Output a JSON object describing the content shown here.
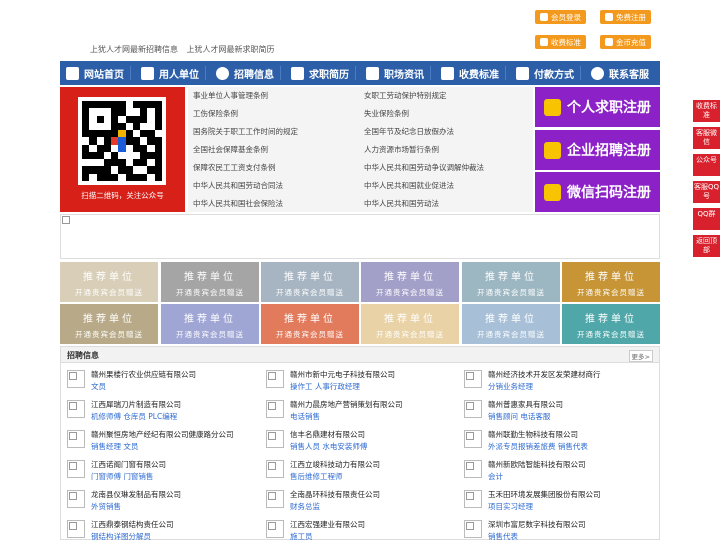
{
  "top": {
    "member_login": "会员登录",
    "free_register": "免费注册",
    "fee_standard": "收费标准",
    "gold_recharge": "金币充值",
    "newest_jobs": "上犹人才网最新招聘信息",
    "newest_resumes": "上犹人才网最新求职简历"
  },
  "nav": [
    "网站首页",
    "用人单位",
    "招聘信息",
    "求职简历",
    "职场资讯",
    "收费标准",
    "付款方式",
    "联系客服"
  ],
  "qr_caption": "扫描二维码，关注公众号",
  "laws": [
    "事业单位人事管理条例",
    "女职工劳动保护特别规定",
    "工伤保险条例",
    "失业保险条例",
    "国务院关于职工工作时间的规定",
    "全国年节及纪念日放假办法",
    "全国社会保障基金条例",
    "人力资源市场暂行条例",
    "保障农民工工资支付条例",
    "中华人民共和国劳动争议调解仲裁法",
    "中华人民共和国劳动合同法",
    "中华人民共和国就业促进法",
    "中华人民共和国社会保险法",
    "中华人民共和国劳动法"
  ],
  "register": {
    "personal": "个人求职注册",
    "company": "企业招聘注册",
    "wechat": "微信扫码注册"
  },
  "tiles": {
    "title": "推荐单位",
    "subtitle": "开通贵宾会员赠送",
    "colors": [
      "#d9cfb8",
      "#a5a5a5",
      "#a7b4c2",
      "#a29fc8",
      "#9db7c2",
      "#c79535",
      "#b8aa88",
      "#9fa6d4",
      "#e27a5c",
      "#e8d2a6",
      "#a7c0d8",
      "#4fa7a9"
    ]
  },
  "jobs": {
    "title": "招聘信息",
    "more": "更多>",
    "items": [
      {
        "company": "赣州果楼行农业供应链有限公司",
        "positions": "文员"
      },
      {
        "company": "赣州市新中元电子科技有限公司",
        "positions": "操作工 人事行政经理"
      },
      {
        "company": "赣州经济技术开发区发荣建材商行",
        "positions": "分销业务经理"
      },
      {
        "company": "江西犀瑞刀片制造有限公司",
        "positions": "机修师傅 仓库员 PLC编程"
      },
      {
        "company": "赣州力晨房地产营销策划有限公司",
        "positions": "电话销售"
      },
      {
        "company": "赣州普惠家具有限公司",
        "positions": "销售顾问 电话客服"
      },
      {
        "company": "赣州聚恒房地产经纪有限公司健康路分公司",
        "positions": "销售经理 文员"
      },
      {
        "company": "信丰名鼎建材有限公司",
        "positions": "销售人员 水电安装师傅"
      },
      {
        "company": "赣州联勤生物科技有限公司",
        "positions": "外派专员报销差旅费 销售代表"
      },
      {
        "company": "江西诺阁门窗有限公司",
        "positions": "门窗师傅 门窗销售"
      },
      {
        "company": "江西立竣科技动力有限公司",
        "positions": "售后维修工程师"
      },
      {
        "company": "赣州新欧陆智能科技有限公司",
        "positions": "会计"
      },
      {
        "company": "龙南县仪琳发制品有限公司",
        "positions": "外贸销售"
      },
      {
        "company": "全南晶环科技有限责任公司",
        "positions": "财务总监"
      },
      {
        "company": "玉禾田环境发展集团股份有限公司",
        "positions": "项目实习经理"
      },
      {
        "company": "江西鼎泰钢结构责任公司",
        "positions": "钢结构详图分解员"
      },
      {
        "company": "江西宏强建业有限公司",
        "positions": "施工员"
      },
      {
        "company": "深圳市富尼数字科技有限公司",
        "positions": "销售代表"
      }
    ]
  },
  "side": [
    "收费标准",
    "客服微信",
    "公众号",
    "客服QQ号",
    "QQ群",
    "返回顶部"
  ]
}
